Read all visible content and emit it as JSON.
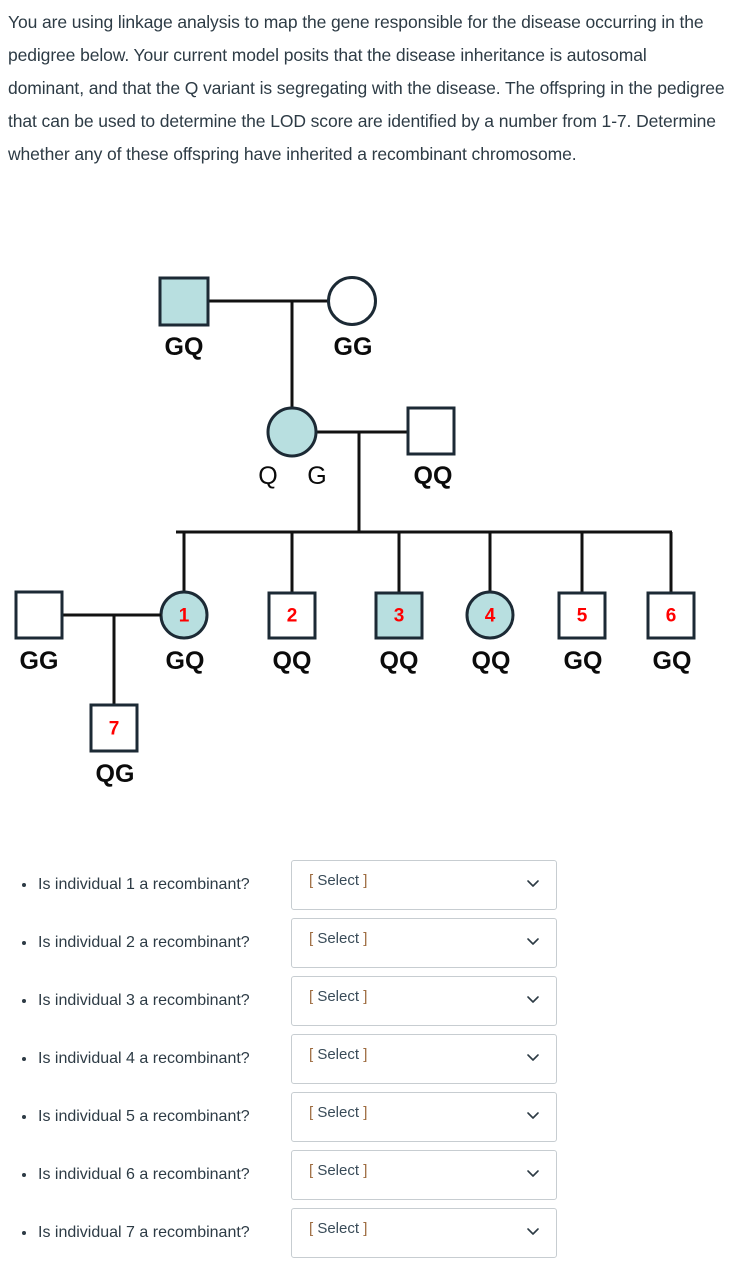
{
  "question": {
    "prompt": "You are using linkage analysis to map the gene responsible for the disease occurring in the pedigree below. Your current model posits that the disease inheritance is autosomal dominant, and that the Q variant is segregating with the disease. The offspring in the pedigree that can be used to determine the LOD score are identified by a number from 1-7. Determine whether any of these offspring have inherited a recombinant chromosome."
  },
  "colors": {
    "affected_fill": "#b8dfe0",
    "unaffected_fill": "#ffffff",
    "shape_stroke": "#1c2a35",
    "line": "#111111",
    "number": "#ff0000",
    "text": "#2d3b45",
    "select_border": "#c7cdd1",
    "bracket": "#9d6b3f"
  },
  "pedigree": {
    "generation1": [
      {
        "id": "g1-father",
        "shape": "square",
        "affected": true,
        "genotype": "GQ"
      },
      {
        "id": "g1-mother",
        "shape": "circle",
        "affected": false,
        "genotype": "GG"
      }
    ],
    "generation2": [
      {
        "id": "g2-mother",
        "shape": "circle",
        "affected": true,
        "allele_left": "Q",
        "allele_right": "G"
      },
      {
        "id": "g2-father",
        "shape": "square",
        "affected": false,
        "genotype": "QQ"
      }
    ],
    "generation2_spouse": {
      "id": "g2-spouse-left",
      "shape": "square",
      "affected": false,
      "genotype": "GG"
    },
    "offspring": [
      {
        "number": "1",
        "shape": "circle",
        "affected": true,
        "genotype": "GQ"
      },
      {
        "number": "2",
        "shape": "square",
        "affected": false,
        "genotype": "QQ"
      },
      {
        "number": "3",
        "shape": "square",
        "affected": true,
        "genotype": "QQ"
      },
      {
        "number": "4",
        "shape": "circle",
        "affected": true,
        "genotype": "QQ"
      },
      {
        "number": "5",
        "shape": "square",
        "affected": false,
        "genotype": "GQ"
      },
      {
        "number": "6",
        "shape": "square",
        "affected": false,
        "genotype": "GQ"
      }
    ],
    "generation4": [
      {
        "number": "7",
        "shape": "square",
        "affected": false,
        "genotype": "QG"
      }
    ]
  },
  "questions": {
    "select_placeholder": "[ Select ]",
    "items": [
      {
        "label": "Is individual 1 a recombinant?",
        "value": "[ Select ]"
      },
      {
        "label": "Is individual 2 a recombinant?",
        "value": "[ Select ]"
      },
      {
        "label": "Is individual 3 a recombinant?",
        "value": "[ Select ]"
      },
      {
        "label": "Is individual 4 a recombinant?",
        "value": "[ Select ]"
      },
      {
        "label": "Is individual 5 a recombinant?",
        "value": "[ Select ]"
      },
      {
        "label": "Is individual 6 a recombinant?",
        "value": "[ Select ]"
      },
      {
        "label": "Is individual 7 a recombinant?",
        "value": "[ Select ]"
      }
    ]
  }
}
